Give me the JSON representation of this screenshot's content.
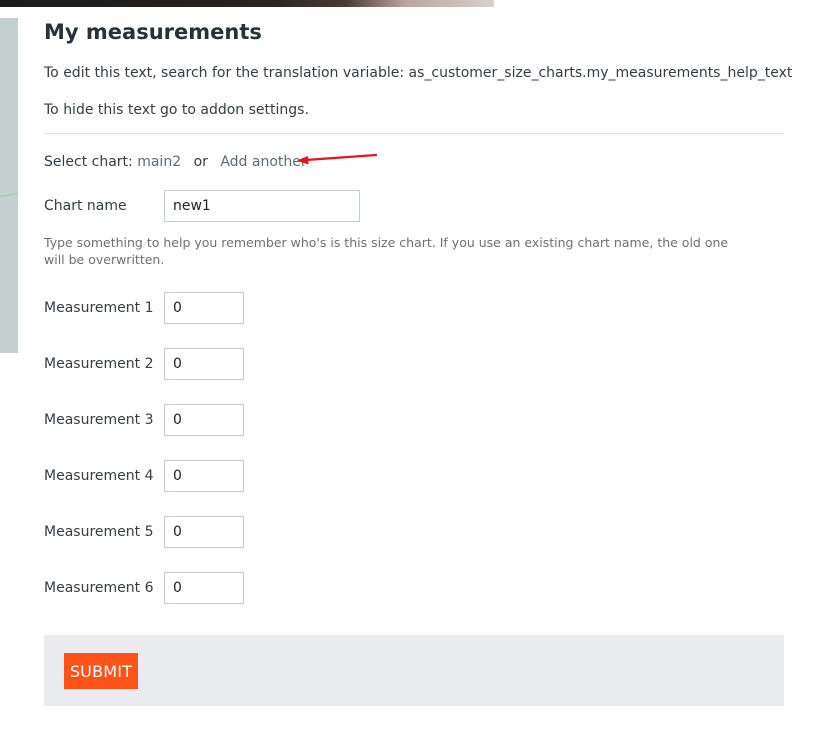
{
  "page": {
    "title": "My measurements",
    "help_text_1": "To edit this text, search for the translation variable: as_customer_size_charts.my_measurements_help_text",
    "help_text_2": "To hide this text go to addon settings."
  },
  "chart_select": {
    "label": "Select chart:",
    "current_chart": "main2",
    "or_text": "or",
    "add_another": "Add another"
  },
  "chart_name": {
    "label": "Chart name",
    "value": "new1",
    "hint": "Type something to help you remember who's is this size chart. If you use an existing chart name, the old one will be overwritten."
  },
  "measurements": [
    {
      "label": "Measurement 1",
      "value": "0"
    },
    {
      "label": "Measurement 2",
      "value": "0"
    },
    {
      "label": "Measurement 3",
      "value": "0"
    },
    {
      "label": "Measurement 4",
      "value": "0"
    },
    {
      "label": "Measurement 5",
      "value": "0"
    },
    {
      "label": "Measurement 6",
      "value": "0"
    }
  ],
  "submit": {
    "label": "SUBMIT"
  },
  "colors": {
    "accent": "#ff5319",
    "annotation_arrow": "#e8141b",
    "submit_bar": "#e9ebee"
  }
}
